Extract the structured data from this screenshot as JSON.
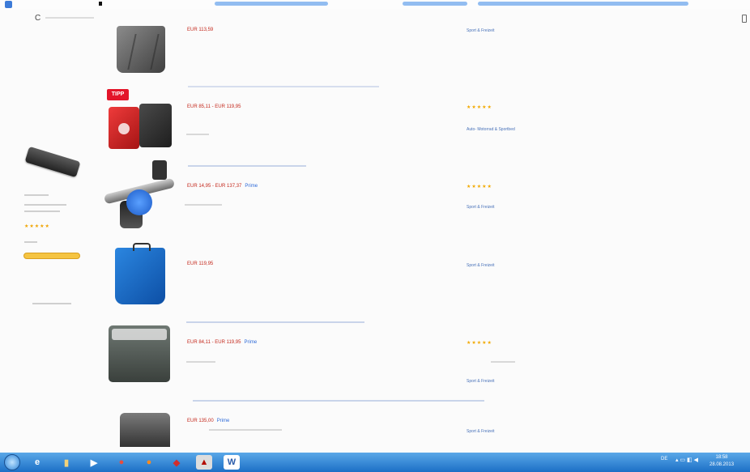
{
  "browser": {
    "crumb_letter": "C",
    "scroll_icon": "square-outline-icon"
  },
  "sidebar": {
    "product_icon": "black-case-product-image",
    "stars": "★★★★★"
  },
  "results": [
    {
      "id": "r1",
      "image": "grey-pannier-bag",
      "price_text": "EUR 113,59",
      "category_text": "Sport & Freizeit"
    },
    {
      "id": "r2",
      "badge": "TIPP",
      "image": "red-black-pannier-bags",
      "price_text": "EUR 85,11 - EUR 119,95",
      "stars": "★★★★★",
      "category_text": "Auto- Motorrad & Sportbed"
    },
    {
      "id": "r3",
      "image": "handlebar-mount",
      "price_text": "EUR 14,95 - EUR 137,37",
      "prime_text": "Prime",
      "stars": "★★★★★",
      "category_text": "Sport & Freizeit"
    },
    {
      "id": "r4",
      "image": "blue-pannier-bag",
      "price_text": "EUR 119,95",
      "category_text": "Sport & Freizeit"
    },
    {
      "id": "r5",
      "image": "grey-handlebar-box",
      "price_text": "EUR 84,11 - EUR 119,95",
      "prime_text": "Prime",
      "stars": "★★★★★",
      "category_text": "Sport & Freizeit"
    },
    {
      "id": "r6",
      "image": "grey-bag-partial",
      "price_text": "EUR 135,00",
      "prime_text": "Prime",
      "category_text": "Sport & Freizeit"
    }
  ],
  "taskbar": {
    "start_icon": "windows-start-orb",
    "apps": [
      {
        "name": "ie-browser-icon",
        "glyph": "e"
      },
      {
        "name": "explorer-folder-icon",
        "glyph": "▮"
      },
      {
        "name": "media-player-icon",
        "glyph": "▶"
      },
      {
        "name": "chrome-icon",
        "glyph": "●"
      },
      {
        "name": "firefox-icon",
        "glyph": "●"
      },
      {
        "name": "app-icon-generic",
        "glyph": "◆"
      },
      {
        "name": "acrobat-icon",
        "glyph": "▲"
      },
      {
        "name": "word-icon",
        "glyph": "W"
      }
    ],
    "tray_lang": "DE",
    "clock_time": "18:58",
    "clock_date": "28.08.2013"
  },
  "colors": {
    "price": "#c4281c",
    "link": "#1a4ea8",
    "star": "#f2a900",
    "taskbar": "#1c6fc6"
  }
}
